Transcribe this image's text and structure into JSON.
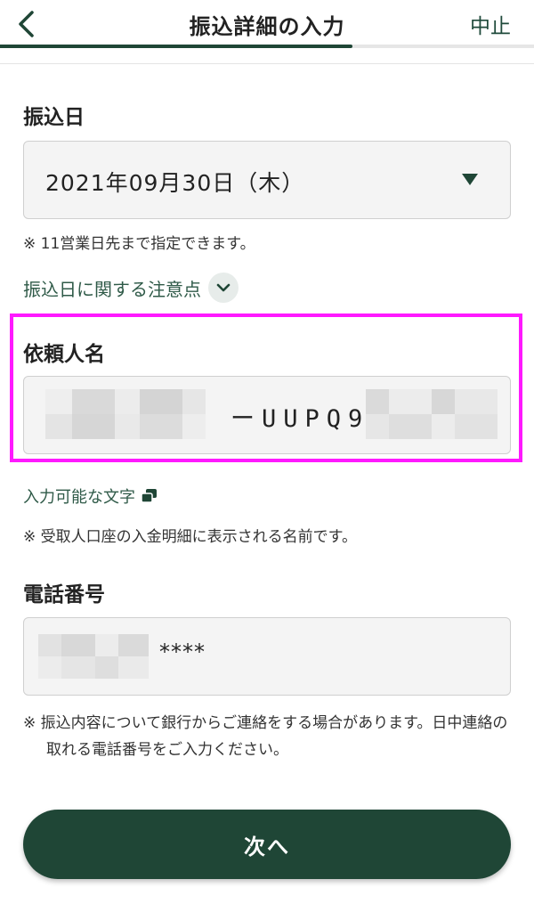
{
  "header": {
    "title": "振込詳細の入力",
    "cancel_label": "中止",
    "progress": 0.66
  },
  "transfer_date": {
    "label": "振込日",
    "value": "2021年09月30日（木）",
    "note": "※ 11営業日先まで指定できます。",
    "caution_link": "振込日に関する注意点"
  },
  "requester": {
    "label": "依頼人名",
    "visible_value": "ーUUPQ9",
    "chars_link": "入力可能な文字",
    "note": "※ 受取人口座の入金明細に表示される名前です。"
  },
  "phone": {
    "label": "電話番号",
    "visible_value": "****",
    "note": "※ 振込内容について銀行からご連絡をする場合があります。日中連絡の取れる電話番号をご入力ください。"
  },
  "next_button": {
    "label": "次へ"
  },
  "colors": {
    "brand_green": "#1f4636",
    "link_green": "#2f5a48",
    "highlight_magenta": "#ff19ff"
  }
}
